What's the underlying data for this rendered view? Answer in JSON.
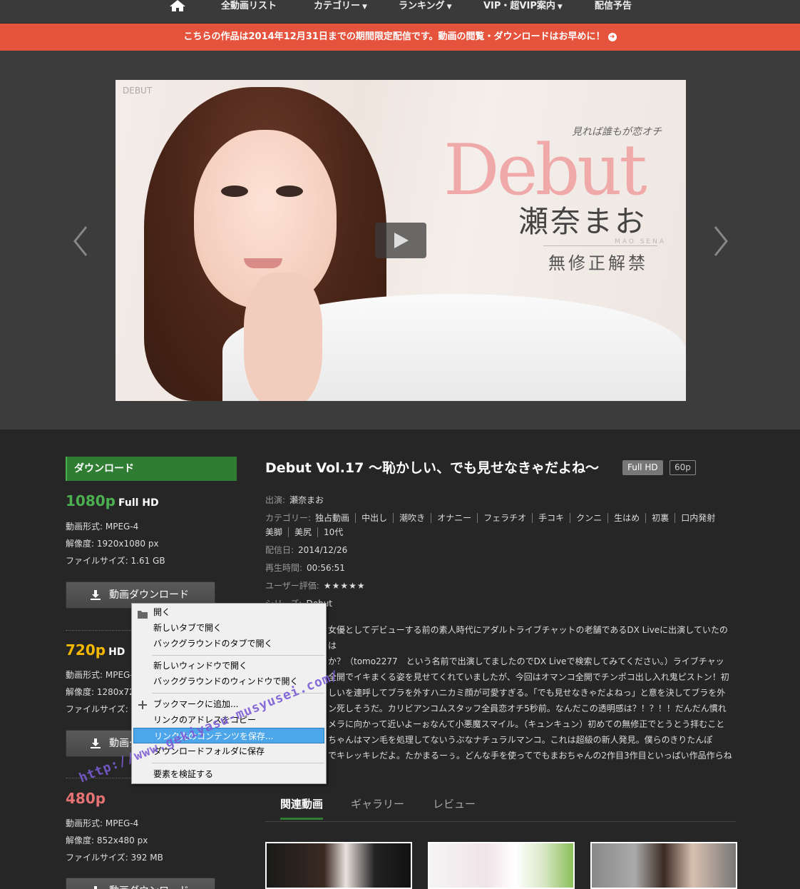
{
  "nav": {
    "items": [
      "全動画リスト",
      "カテゴリー",
      "ランキング",
      "VIP・超VIP案内",
      "配信予告"
    ],
    "home_icon": "home-icon"
  },
  "notice": {
    "text": "こちらの作品は2014年12月31日までの期間限定配信です。動画の閲覧・ダウンロードはお早めに！"
  },
  "hero": {
    "tagline": "見れば誰もが恋オチ",
    "logo": "DEBUT",
    "debut": "Debut",
    "name": "瀬奈まお",
    "name_en": "MAO SENA",
    "sub": "無修正解禁"
  },
  "download": {
    "header": "ダウンロード",
    "button_label": "動画ダウンロード",
    "items": [
      {
        "res": "1080p",
        "tag": "Full HD",
        "color": "#4caf50",
        "format": "動画形式: MPEG-4",
        "resolution": "解像度: 1920x1080 px",
        "size": "ファイルサイズ: 1.61 GB"
      },
      {
        "res": "720p",
        "tag": "HD",
        "color": "#f5b800",
        "format": "動画形式: MPEG-4",
        "resolution": "解像度: 1280x720 px",
        "size": "ファイルサイズ:"
      },
      {
        "res": "480p",
        "tag": "",
        "color": "#e57373",
        "format": "動画形式: MPEG-4",
        "resolution": "解像度: 852x480 px",
        "size": "ファイルサイズ: 392 MB"
      }
    ]
  },
  "movie": {
    "title": "Debut Vol.17 ～恥かしい、でも見せなきゃだよね～",
    "badges": [
      "Full HD",
      "60p"
    ],
    "cast_label": "出演:",
    "cast": "瀬奈まお",
    "category_label": "カテゴリー:",
    "categories": [
      "独占動画",
      "中出し",
      "潮吹き",
      "オナニー",
      "フェラチオ",
      "手コキ",
      "クンニ",
      "生はめ",
      "初裏",
      "口内発射",
      "美脚",
      "美尻",
      "10代"
    ],
    "date_label": "配信日:",
    "date": "2014/12/26",
    "duration_label": "再生時間:",
    "duration": "00:56:51",
    "rating_label": "ユーザー評価:",
    "rating": "★★★★★",
    "series_label": "シリーズ:",
    "series": "Debut",
    "description": [
      "女優としてデビューする前の素人時代にアダルトライブチャットの老舗であるDX Liveに出演していたのは",
      "か？（tomo2277　という名前で出演してましたのでDX Liveで検索してみてください。）ライブチャッ",
      "全開でイキまくる姿を見せてくれていましたが、今回はオマンコ全開でチンポコ出し入れ鬼ピストン！初",
      "しいを連呼してブラを外すハニカミ顔が可愛すぎる。「でも見せなきゃだよねっ」と意を決してブラを外",
      "ン死しそうだ。カリビアンコムスタッフ全員恋オチ5秒前。なんだこの透明感は？！？！！だんだん慣れ",
      "メラに向かって近いよーぉなんて小悪魔スマイル。（キュンキュン）初めての無修正でとうとう拝むこと",
      "ちゃんはマン毛を処理してないうぶなナチュラルマンコ。これは超級の新人発見。僕らのきりたんぽ",
      "でキレッキレだよ。たかまるーぅ。どんな手を使ってでもまおちゃんの2作目3作目といっぱい作品作らね"
    ]
  },
  "tabs": [
    "関連動画",
    "ギャラリー",
    "レビュー"
  ],
  "context_menu": {
    "items": [
      "開く",
      "新しいタブで開く",
      "バックグラウンドのタブで開く",
      "新しいウィンドウで開く",
      "バックグラウンドのウィンドウで開く",
      "ブックマークに追加...",
      "リンクのアドレスをコピー",
      "リンク先のコンテンツを保存...",
      "ダウンロードフォルダに保存",
      "要素を検証する"
    ]
  },
  "watermark": "http://www.gekiyasu-musyusei.com/"
}
